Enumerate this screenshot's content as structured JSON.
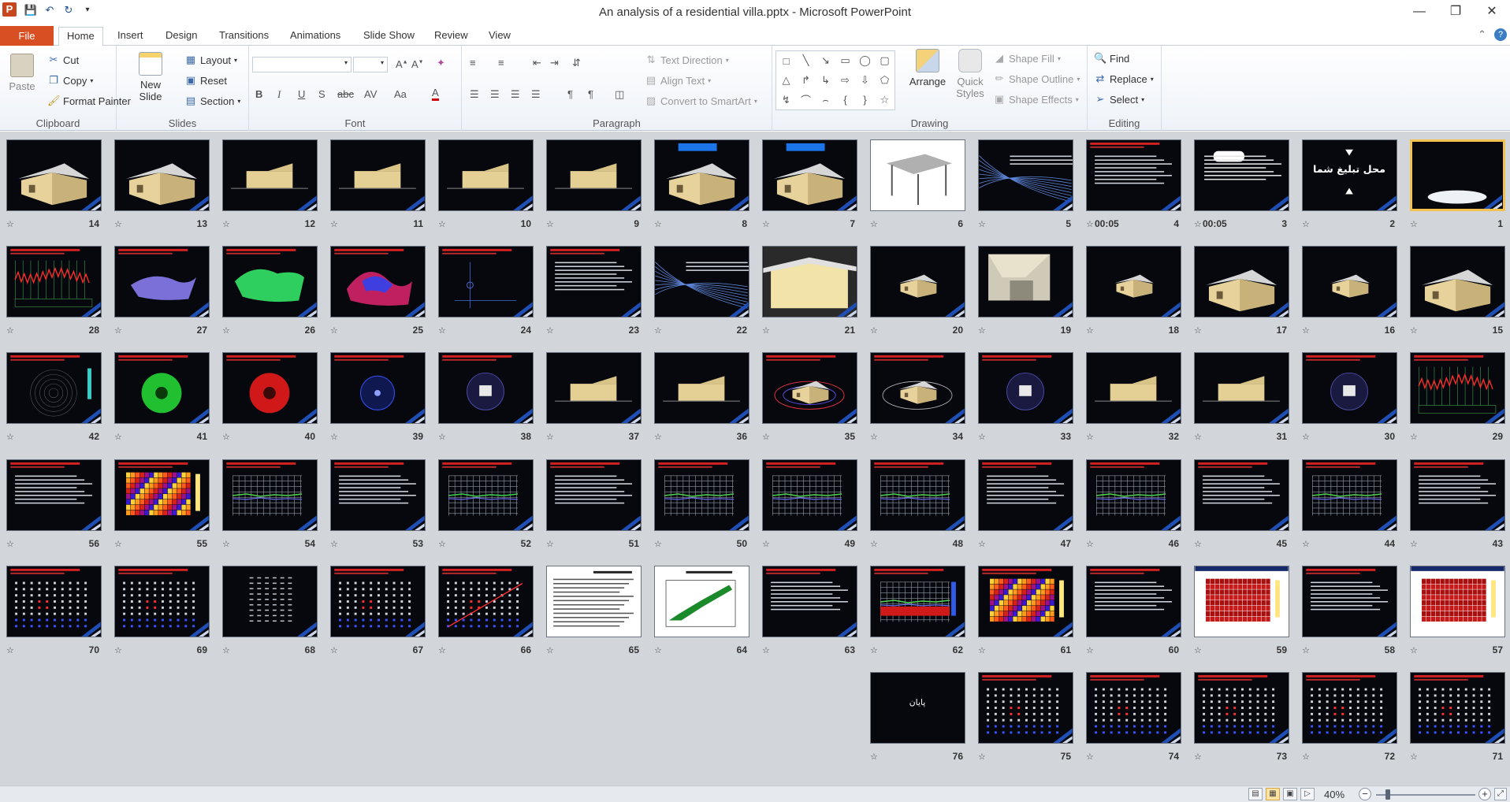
{
  "window": {
    "title": "An analysis of a residential villa.pptx - Microsoft PowerPoint",
    "app_icon_letter": "P"
  },
  "tabs": {
    "file": "File",
    "items": [
      "Home",
      "Insert",
      "Design",
      "Transitions",
      "Animations",
      "Slide Show",
      "Review",
      "View"
    ],
    "active": "Home"
  },
  "ribbon": {
    "clipboard": {
      "label": "Clipboard",
      "paste": "Paste",
      "cut": "Cut",
      "copy": "Copy",
      "format_painter": "Format Painter"
    },
    "slides": {
      "label": "Slides",
      "new_slide_1": "New",
      "new_slide_2": "Slide",
      "layout": "Layout",
      "reset": "Reset",
      "section": "Section"
    },
    "font": {
      "label": "Font",
      "bold": "B",
      "italic": "I",
      "underline": "U",
      "shadow": "S",
      "strike": "abc",
      "spacing": "AV",
      "case": "Aa",
      "color": "A"
    },
    "paragraph": {
      "label": "Paragraph",
      "text_direction": "Text Direction",
      "align_text": "Align Text",
      "convert_smartart": "Convert to SmartArt"
    },
    "drawing": {
      "label": "Drawing",
      "arrange": "Arrange",
      "quick_styles_1": "Quick",
      "quick_styles_2": "Styles",
      "shape_fill": "Shape Fill",
      "shape_outline": "Shape Outline",
      "shape_effects": "Shape Effects"
    },
    "editing": {
      "label": "Editing",
      "find": "Find",
      "replace": "Replace",
      "select": "Select"
    }
  },
  "slides": [
    {
      "n": "1",
      "style": "selected-cloud"
    },
    {
      "n": "2",
      "style": "arabic-text"
    },
    {
      "n": "3",
      "style": "text-box",
      "time": "00:05"
    },
    {
      "n": "4",
      "style": "text",
      "time": "00:05"
    },
    {
      "n": "5",
      "style": "blue-lines"
    },
    {
      "n": "6",
      "style": "white-model"
    },
    {
      "n": "7",
      "style": "house-blue-title"
    },
    {
      "n": "8",
      "style": "house-blue-title"
    },
    {
      "n": "9",
      "style": "elevation"
    },
    {
      "n": "10",
      "style": "elevation"
    },
    {
      "n": "11",
      "style": "elevation"
    },
    {
      "n": "12",
      "style": "elevation"
    },
    {
      "n": "13",
      "style": "house"
    },
    {
      "n": "14",
      "style": "house"
    },
    {
      "n": "15",
      "style": "house"
    },
    {
      "n": "16",
      "style": "house-small"
    },
    {
      "n": "17",
      "style": "house"
    },
    {
      "n": "18",
      "style": "house-small"
    },
    {
      "n": "19",
      "style": "render"
    },
    {
      "n": "20",
      "style": "house-small"
    },
    {
      "n": "21",
      "style": "render-lit"
    },
    {
      "n": "22",
      "style": "blue-lines"
    },
    {
      "n": "23",
      "style": "text"
    },
    {
      "n": "24",
      "style": "graph-blue"
    },
    {
      "n": "25",
      "style": "surface-rb"
    },
    {
      "n": "26",
      "style": "surface-green"
    },
    {
      "n": "27",
      "style": "surface-purple"
    },
    {
      "n": "28",
      "style": "red-wave"
    },
    {
      "n": "29",
      "style": "red-wave"
    },
    {
      "n": "30",
      "style": "sun-path"
    },
    {
      "n": "31",
      "style": "elevation"
    },
    {
      "n": "32",
      "style": "elevation"
    },
    {
      "n": "33",
      "style": "sun-path"
    },
    {
      "n": "34",
      "style": "sun-ring"
    },
    {
      "n": "35",
      "style": "sun-ring-red"
    },
    {
      "n": "36",
      "style": "elevation"
    },
    {
      "n": "37",
      "style": "elevation"
    },
    {
      "n": "38",
      "style": "sun-path"
    },
    {
      "n": "39",
      "style": "radial-blue"
    },
    {
      "n": "40",
      "style": "radial-red"
    },
    {
      "n": "41",
      "style": "radial-green"
    },
    {
      "n": "42",
      "style": "radial-grey"
    },
    {
      "n": "43",
      "style": "text"
    },
    {
      "n": "44",
      "style": "grid-chart"
    },
    {
      "n": "45",
      "style": "text"
    },
    {
      "n": "46",
      "style": "grid-chart"
    },
    {
      "n": "47",
      "style": "text"
    },
    {
      "n": "48",
      "style": "grid-chart"
    },
    {
      "n": "49",
      "style": "grid-chart"
    },
    {
      "n": "50",
      "style": "grid-chart"
    },
    {
      "n": "51",
      "style": "text"
    },
    {
      "n": "52",
      "style": "grid-green"
    },
    {
      "n": "53",
      "style": "text"
    },
    {
      "n": "54",
      "style": "grid-chart"
    },
    {
      "n": "55",
      "style": "heatmap"
    },
    {
      "n": "56",
      "style": "text"
    },
    {
      "n": "57",
      "style": "white-heat"
    },
    {
      "n": "58",
      "style": "text"
    },
    {
      "n": "59",
      "style": "white-heat"
    },
    {
      "n": "60",
      "style": "text"
    },
    {
      "n": "61",
      "style": "heatmap"
    },
    {
      "n": "62",
      "style": "grid-red"
    },
    {
      "n": "63",
      "style": "text"
    },
    {
      "n": "64",
      "style": "white-scatter"
    },
    {
      "n": "65",
      "style": "white-text"
    },
    {
      "n": "66",
      "style": "grid-line"
    },
    {
      "n": "67",
      "style": "grid-dots"
    },
    {
      "n": "68",
      "style": "table-dark"
    },
    {
      "n": "69",
      "style": "grid-dots"
    },
    {
      "n": "70",
      "style": "grid-dots"
    },
    {
      "n": "71",
      "style": "grid-dots"
    },
    {
      "n": "72",
      "style": "grid-dots"
    },
    {
      "n": "73",
      "style": "grid-dots"
    },
    {
      "n": "74",
      "style": "grid-dots"
    },
    {
      "n": "75",
      "style": "grid-dots"
    },
    {
      "n": "76",
      "style": "end-title"
    }
  ],
  "slide_texts": {
    "slide2": "محل تبلیغ شما",
    "slide76": "پایان"
  },
  "status": {
    "zoom": "40%"
  },
  "colors": {
    "file_tab": "#d84f23",
    "accent": "#f2c14e",
    "sorter_bg": "#d2d5d9"
  }
}
